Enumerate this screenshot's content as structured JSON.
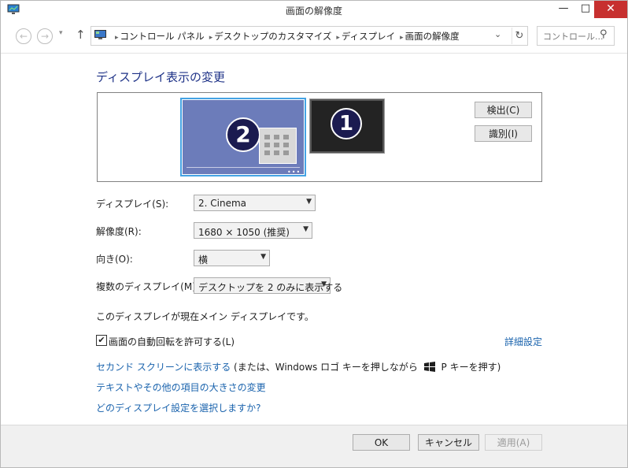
{
  "window": {
    "title": "画面の解像度"
  },
  "titlebar_buttons": {
    "minimize": "—",
    "maximize": "□",
    "close": "✕"
  },
  "nav": {
    "back": "←",
    "forward": "→",
    "recent": "▾",
    "up": "↑",
    "breadcrumbs": [
      "コントロール パネル",
      "デスクトップのカスタマイズ",
      "ディスプレイ",
      "画面の解像度"
    ],
    "separator": "▸",
    "dropdown": "⌄",
    "refresh": "↻",
    "search_placeholder": "コントロール...",
    "search_icon": "⚲"
  },
  "heading": "ディスプレイ表示の変更",
  "monitors": {
    "secondary_number": "2",
    "primary_number": "1",
    "dots": "•••"
  },
  "buttons": {
    "detect": "検出(C)",
    "identify": "識別(I)",
    "ok": "OK",
    "cancel": "キャンセル",
    "apply": "適用(A)"
  },
  "settings": {
    "display_label": "ディスプレイ(S):",
    "display_value": "2. Cinema",
    "resolution_label": "解像度(R):",
    "resolution_value": "1680 × 1050 (推奨)",
    "orientation_label": "向き(O):",
    "orientation_value": "横",
    "multi_label": "複数のディスプレイ(M):",
    "multi_value": "デスクトップを 2 のみに表示する",
    "arrow": "▼"
  },
  "main_note": "このディスプレイが現在メイン ディスプレイです。",
  "auto_rotate": {
    "checked": true,
    "check_mark": "✔",
    "label": "画面の自動回転を許可する(L)"
  },
  "links": {
    "advanced": "詳細設定",
    "second_screen": "セカンド スクリーンに表示する",
    "second_screen_hint_pre": " (または、Windows ロゴ キーを押しながら ",
    "second_screen_hint_post": " P キーを押す)",
    "text_size": "テキストやその他の項目の大きさの変更",
    "which_settings": "どのディスプレイ設定を選択しますか?"
  },
  "colors": {
    "accent_link": "#1a63ad",
    "heading": "#1e3287",
    "selected_monitor": "#6c7cba",
    "close_button": "#c7302f"
  }
}
